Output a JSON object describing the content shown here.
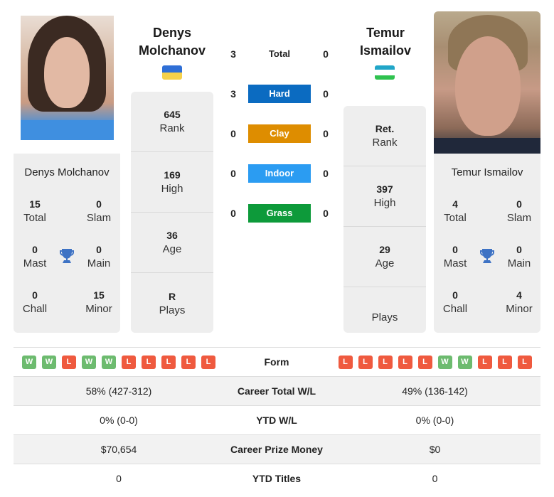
{
  "player_left": {
    "name_header_line1": "Denys",
    "name_header_line2": "Molchanov",
    "full_name": "Denys Molchanov",
    "flag": "ukraine-flag",
    "photo": "player-photo",
    "rank": {
      "value": "645",
      "label": "Rank"
    },
    "high": {
      "value": "169",
      "label": "High"
    },
    "age": {
      "value": "36",
      "label": "Age"
    },
    "plays": {
      "value": "R",
      "label": "Plays"
    },
    "titles": {
      "total": {
        "value": "15",
        "label": "Total"
      },
      "slam": {
        "value": "0",
        "label": "Slam"
      },
      "mast": {
        "value": "0",
        "label": "Mast"
      },
      "main": {
        "value": "0",
        "label": "Main"
      },
      "chall": {
        "value": "0",
        "label": "Chall"
      },
      "minor": {
        "value": "15",
        "label": "Minor"
      }
    },
    "form": [
      "W",
      "W",
      "L",
      "W",
      "W",
      "L",
      "L",
      "L",
      "L",
      "L"
    ]
  },
  "player_right": {
    "name_header_line1": "Temur",
    "name_header_line2": "Ismailov",
    "full_name": "Temur Ismailov",
    "flag": "uzbekistan-flag",
    "photo": "player-photo",
    "rank": {
      "value": "Ret.",
      "label": "Rank"
    },
    "high": {
      "value": "397",
      "label": "High"
    },
    "age": {
      "value": "29",
      "label": "Age"
    },
    "plays": {
      "value": "",
      "label": "Plays"
    },
    "titles": {
      "total": {
        "value": "4",
        "label": "Total"
      },
      "slam": {
        "value": "0",
        "label": "Slam"
      },
      "mast": {
        "value": "0",
        "label": "Mast"
      },
      "main": {
        "value": "0",
        "label": "Main"
      },
      "chall": {
        "value": "0",
        "label": "Chall"
      },
      "minor": {
        "value": "4",
        "label": "Minor"
      }
    },
    "form": [
      "L",
      "L",
      "L",
      "L",
      "L",
      "W",
      "W",
      "L",
      "L",
      "L"
    ]
  },
  "h2h": [
    {
      "label": "Total",
      "left": "3",
      "right": "0",
      "color": ""
    },
    {
      "label": "Hard",
      "left": "3",
      "right": "0",
      "color": "#0b6bc1"
    },
    {
      "label": "Clay",
      "left": "0",
      "right": "0",
      "color": "#de8d00"
    },
    {
      "label": "Indoor",
      "left": "0",
      "right": "0",
      "color": "#2b9cf2"
    },
    {
      "label": "Grass",
      "left": "0",
      "right": "0",
      "color": "#0d9a3a"
    }
  ],
  "comparison": {
    "form_label": "Form",
    "rows": [
      {
        "label": "Career Total W/L",
        "left": "58% (427-312)",
        "right": "49% (136-142)"
      },
      {
        "label": "YTD W/L",
        "left": "0% (0-0)",
        "right": "0% (0-0)"
      },
      {
        "label": "Career Prize Money",
        "left": "$70,654",
        "right": "$0"
      },
      {
        "label": "YTD Titles",
        "left": "0",
        "right": "0"
      }
    ]
  },
  "colors": {
    "win": "#6dbb6f",
    "loss": "#ef5a3f",
    "trophy": "#3d72c4",
    "card_bg": "#eeeeee"
  }
}
